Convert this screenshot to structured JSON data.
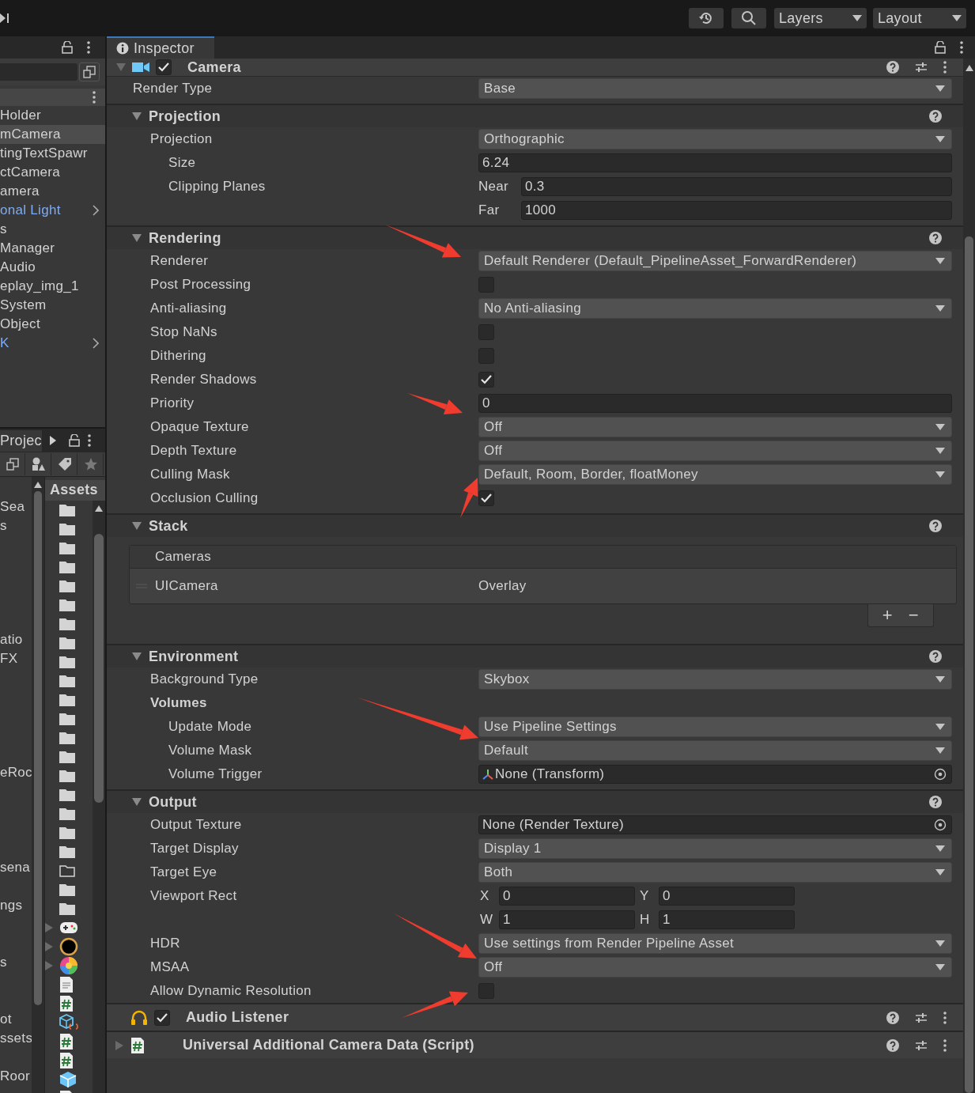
{
  "toolbar": {
    "layers": "Layers",
    "layout": "Layout"
  },
  "hierarchy": {
    "items": [
      {
        "label": "Holder",
        "selected": false,
        "prefab": false,
        "expandable": false
      },
      {
        "label": "mCamera",
        "selected": true,
        "prefab": false,
        "expandable": false
      },
      {
        "label": "tingTextSpawr",
        "selected": false,
        "prefab": false,
        "expandable": false
      },
      {
        "label": "ctCamera",
        "selected": false,
        "prefab": false,
        "expandable": false
      },
      {
        "label": "amera",
        "selected": false,
        "prefab": false,
        "expandable": false
      },
      {
        "label": "onal Light",
        "selected": false,
        "prefab": true,
        "expandable": true
      },
      {
        "label": "s",
        "selected": false,
        "prefab": false,
        "expandable": false
      },
      {
        "label": "Manager",
        "selected": false,
        "prefab": false,
        "expandable": false
      },
      {
        "label": "Audio",
        "selected": false,
        "prefab": false,
        "expandable": false
      },
      {
        "label": "eplay_img_1",
        "selected": false,
        "prefab": false,
        "expandable": false
      },
      {
        "label": "System",
        "selected": false,
        "prefab": false,
        "expandable": false
      },
      {
        "label": "Object",
        "selected": false,
        "prefab": false,
        "expandable": false
      },
      {
        "label": "K",
        "selected": false,
        "prefab": true,
        "expandable": true
      }
    ]
  },
  "project": {
    "tab": "Projec",
    "assets_header": "Assets",
    "tree_items": [
      "Sea",
      "s",
      "atio",
      "FX",
      "eRoc",
      "sena",
      "ngs",
      "s",
      "ot",
      "ssets",
      "Roor"
    ]
  },
  "inspector": {
    "tab": "Inspector",
    "camera": {
      "title": "Camera",
      "enabled": true
    },
    "rows": [
      {
        "kind": "dropdown",
        "label": "Render Type",
        "value": "Base"
      }
    ],
    "sections": [
      {
        "title": "Projection",
        "expanded": true,
        "rows": [
          {
            "kind": "dropdown",
            "label": "Projection",
            "value": "Orthographic",
            "children": [
              {
                "kind": "field",
                "label": "Size",
                "value": "6.24"
              },
              {
                "kind": "pair",
                "label": "Clipping Planes",
                "fields": [
                  {
                    "label": "Near",
                    "value": "0.3"
                  },
                  {
                    "label": "Far",
                    "value": "1000"
                  }
                ]
              }
            ]
          }
        ]
      },
      {
        "title": "Rendering",
        "expanded": true,
        "rows": [
          {
            "kind": "dropdown",
            "label": "Renderer",
            "value": "Default Renderer (Default_PipelineAsset_ForwardRenderer)"
          },
          {
            "kind": "checkbox",
            "label": "Post Processing",
            "checked": false
          },
          {
            "kind": "dropdown",
            "label": "Anti-aliasing",
            "value": "No Anti-aliasing"
          },
          {
            "kind": "checkbox",
            "label": "Stop NaNs",
            "checked": false
          },
          {
            "kind": "checkbox",
            "label": "Dithering",
            "checked": false
          },
          {
            "kind": "checkbox",
            "label": "Render Shadows",
            "checked": true
          },
          {
            "kind": "field",
            "label": "Priority",
            "value": "0"
          },
          {
            "kind": "dropdown",
            "label": "Opaque Texture",
            "value": "Off"
          },
          {
            "kind": "dropdown",
            "label": "Depth Texture",
            "value": "Off"
          },
          {
            "kind": "dropdown",
            "label": "Culling Mask",
            "value": "Default, Room, Border, floatMoney"
          },
          {
            "kind": "checkbox",
            "label": "Occlusion Culling",
            "checked": true
          }
        ]
      },
      {
        "title": "Stack",
        "expanded": true,
        "stack": {
          "header": "Cameras",
          "items": [
            {
              "name": "UICamera",
              "type": "Overlay"
            }
          ],
          "add": "+",
          "remove": "−"
        }
      },
      {
        "title": "Environment",
        "expanded": true,
        "rows": [
          {
            "kind": "dropdown",
            "label": "Background Type",
            "value": "Skybox"
          },
          {
            "kind": "heading",
            "label": "Volumes",
            "children": [
              {
                "kind": "dropdown",
                "label": "Update Mode",
                "value": "Use Pipeline Settings"
              },
              {
                "kind": "dropdown",
                "label": "Volume Mask",
                "value": "Default"
              },
              {
                "kind": "object",
                "label": "Volume Trigger",
                "value": "None (Transform)",
                "icon": true
              }
            ]
          }
        ]
      },
      {
        "title": "Output",
        "expanded": true,
        "rows": [
          {
            "kind": "object",
            "label": "Output Texture",
            "value": "None (Render Texture)",
            "icon": false
          },
          {
            "kind": "dropdown",
            "label": "Target Display",
            "value": "Display 1"
          },
          {
            "kind": "dropdown",
            "label": "Target Eye",
            "value": "Both"
          },
          {
            "kind": "rect",
            "label": "Viewport Rect",
            "fields": [
              {
                "label": "X",
                "value": "0"
              },
              {
                "label": "Y",
                "value": "0"
              },
              {
                "label": "W",
                "value": "1"
              },
              {
                "label": "H",
                "value": "1"
              }
            ]
          },
          {
            "kind": "dropdown",
            "label": "HDR",
            "value": "Use settings from Render Pipeline Asset"
          },
          {
            "kind": "dropdown",
            "label": "MSAA",
            "value": "Off"
          },
          {
            "kind": "checkbox",
            "label": "Allow Dynamic Resolution",
            "checked": false
          }
        ]
      }
    ],
    "components": [
      {
        "kind": "audio",
        "title": "Audio Listener",
        "enabled": true
      },
      {
        "kind": "script",
        "title": "Universal Additional Camera Data (Script)",
        "expanded": false
      }
    ]
  }
}
